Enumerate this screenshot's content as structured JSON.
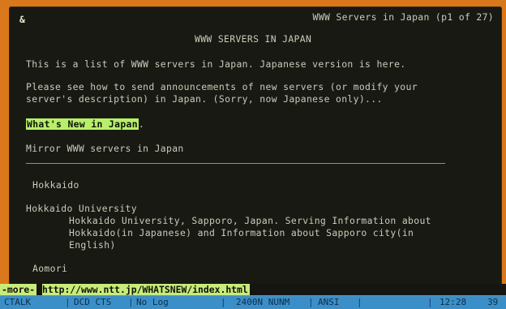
{
  "screen": {
    "corner_glyph": "&",
    "title": "WWW Servers in Japan (p1 of 27)",
    "heading": "WWW SERVERS IN JAPAN",
    "intro": "This is a list of WWW servers in Japan. Japanese version is here.",
    "announce_line1": "Please see how to send announcements of new servers (or modify your",
    "announce_line2": "server's description) in Japan. (Sorry, now Japanese only)...",
    "whats_new_link": "What's New in Japan",
    "whats_new_suffix": ".",
    "mirror_link": "Mirror WWW servers in Japan",
    "regions": [
      {
        "name": "Hokkaido"
      },
      {
        "name": "Aomori"
      }
    ],
    "entries": [
      {
        "title": "Hokkaido University",
        "desc_line1": "Hokkaido University, Sapporo, Japan. Serving Information about",
        "desc_line2": "Hokkaido(in Japanese) and Information about Sapporo city(in",
        "desc_line3": "English)"
      }
    ]
  },
  "prompt": {
    "more": "-more-",
    "url": "http://www.ntt.jp/WHATSNEW/index.html"
  },
  "status_bar": {
    "items": [
      "CTALK",
      "DCD CTS",
      "No Log",
      "2400N NUNM",
      "ANSI",
      "12:28",
      "39"
    ]
  },
  "colors": {
    "frame": "#d9781a",
    "screen_bg": "#181913",
    "text": "#c9ccb9",
    "highlight": "#b8ef69",
    "status_bar": "#3b8fc9"
  }
}
